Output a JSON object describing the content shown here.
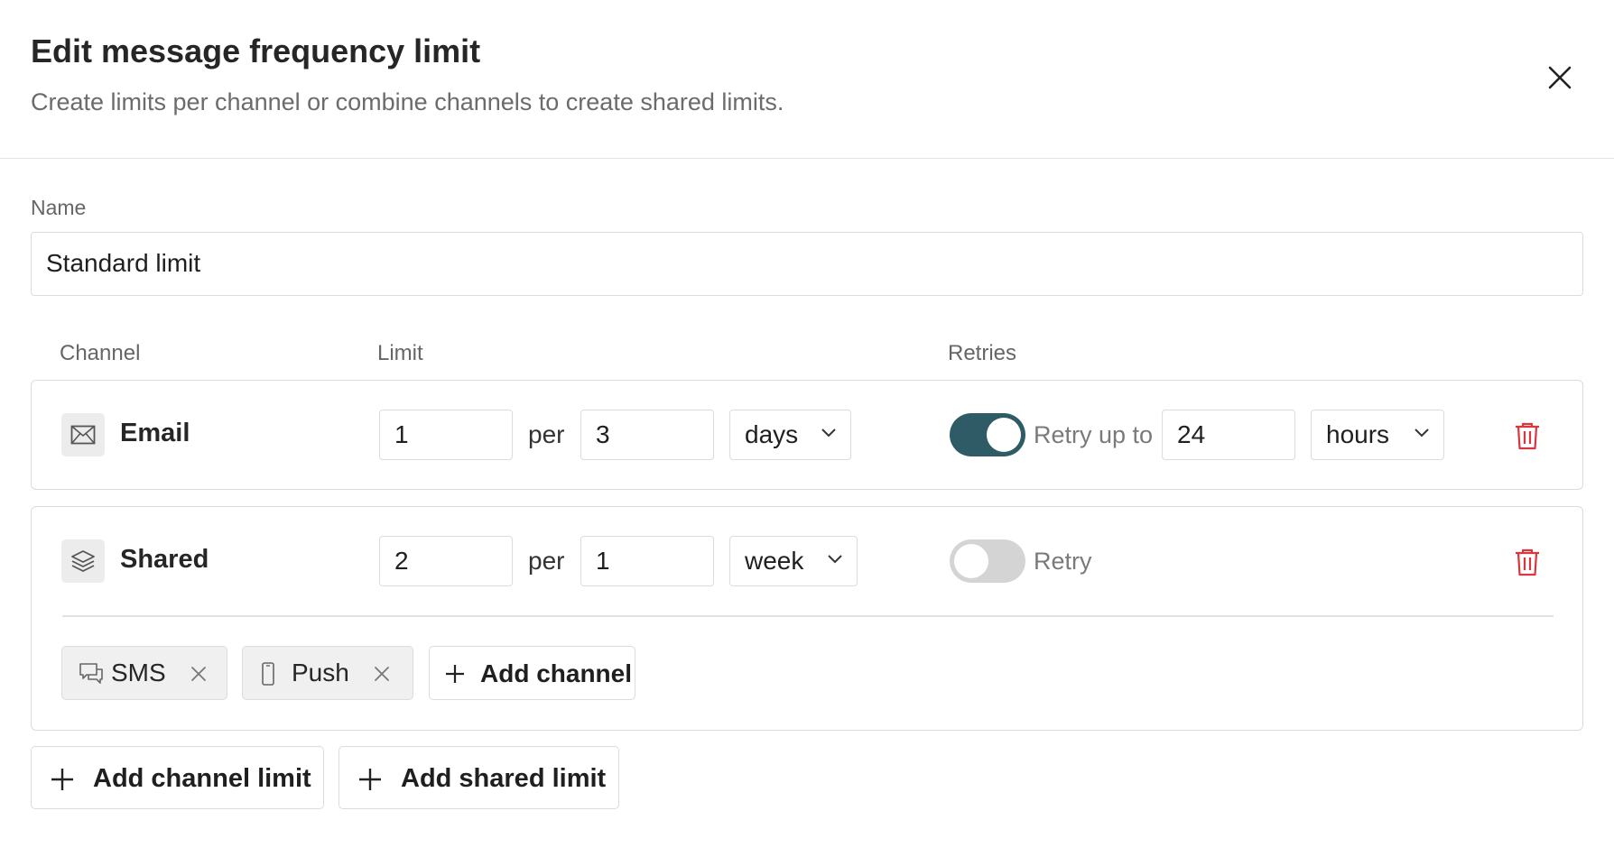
{
  "dialog": {
    "title": "Edit message frequency limit",
    "subtitle": "Create limits per channel or combine channels to create shared limits."
  },
  "name_field": {
    "label": "Name",
    "value": "Standard limit"
  },
  "columns": {
    "channel": "Channel",
    "limit": "Limit",
    "retries": "Retries"
  },
  "limits": [
    {
      "channel": "Email",
      "icon": "envelope-icon",
      "count": "1",
      "per_label": "per",
      "period_value": "3",
      "period_unit": "days",
      "retry_enabled": true,
      "retry_label": "Retry up to",
      "retry_value": "24",
      "retry_unit": "hours"
    },
    {
      "channel": "Shared",
      "icon": "layers-icon",
      "count": "2",
      "per_label": "per",
      "period_value": "1",
      "period_unit": "week",
      "retry_enabled": false,
      "retry_label": "Retry",
      "channels": [
        {
          "label": "SMS",
          "icon": "chat-bubbles-icon"
        },
        {
          "label": "Push",
          "icon": "mobile-phone-icon"
        }
      ],
      "add_channel_label": "Add channel"
    }
  ],
  "actions": {
    "add_channel_limit": "Add channel limit",
    "add_shared_limit": "Add shared limit"
  },
  "colors": {
    "toggle_on": "#2e5b66",
    "toggle_off": "#d4d4d4",
    "danger": "#d9363e"
  }
}
